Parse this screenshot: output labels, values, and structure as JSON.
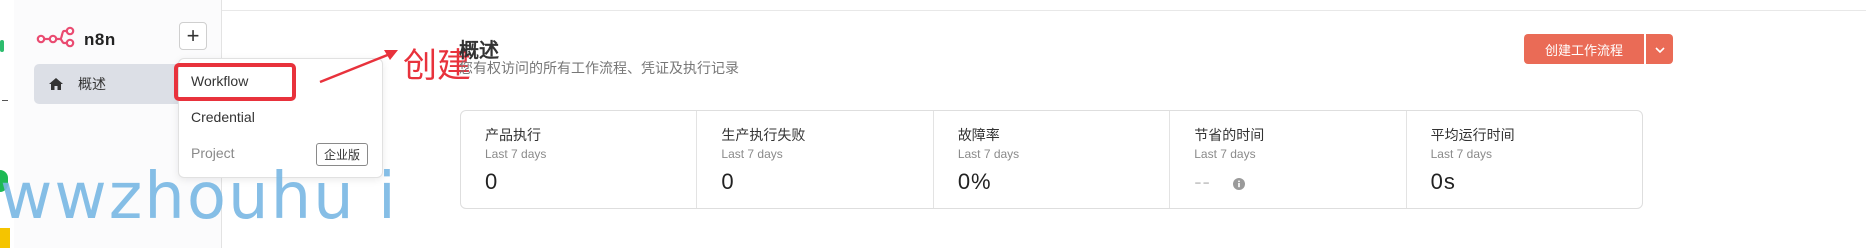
{
  "app": {
    "logo_text": "n8n"
  },
  "sidebar": {
    "add_label": "+",
    "items": [
      {
        "label": "概述",
        "icon": "home-icon"
      }
    ]
  },
  "dropdown": {
    "workflow": "Workflow",
    "credential": "Credential",
    "project": "Project",
    "project_badge": "企业版"
  },
  "annotation": {
    "text": "创建",
    "color": "#e8323c"
  },
  "main": {
    "title": "概述",
    "subtitle": "您有权访问的所有工作流程、凭证及执行记录",
    "create_button": "创建工作流程"
  },
  "stats": [
    {
      "label": "产品执行",
      "period": "Last 7 days",
      "value": "0"
    },
    {
      "label": "生产执行失败",
      "period": "Last 7 days",
      "value": "0"
    },
    {
      "label": "故障率",
      "period": "Last 7 days",
      "value": "0%"
    },
    {
      "label": "节省的时间",
      "period": "Last 7 days",
      "value": "--"
    },
    {
      "label": "平均运行时间",
      "period": "Last 7 days",
      "value": "0s"
    }
  ],
  "watermark": "wwzhouhu i",
  "colors": {
    "accent": "#ea6b56",
    "annotation": "#e8323c",
    "nav_active_bg": "#dcdfe6"
  }
}
